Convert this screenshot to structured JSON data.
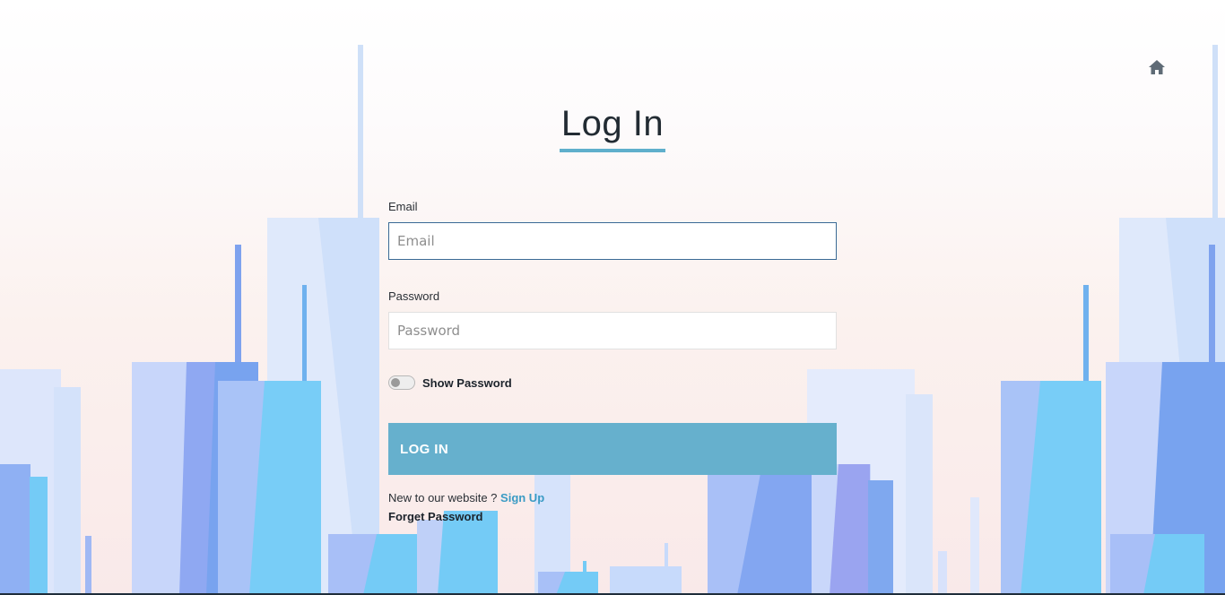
{
  "header": {
    "home_icon": "home-icon"
  },
  "page": {
    "title": "Log In"
  },
  "form": {
    "email_label": "Email",
    "email_placeholder": "Email",
    "email_value": "",
    "password_label": "Password",
    "password_placeholder": "Password",
    "password_value": "",
    "show_password_label": "Show Password",
    "show_password_on": false,
    "login_button_label": "LOG IN"
  },
  "footer_links": {
    "new_user_text": "New to our website ?",
    "signup_label": "Sign Up",
    "forget_password_label": "Forget Password"
  },
  "colors": {
    "accent": "#66b0cd",
    "title_underline": "#5fafcc",
    "link": "#3a9bc4",
    "focused_border": "#3a6a95"
  }
}
